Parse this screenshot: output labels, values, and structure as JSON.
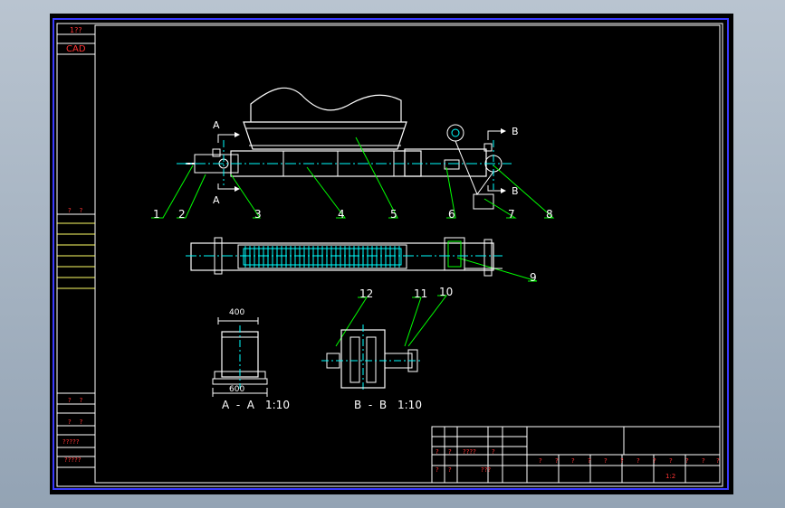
{
  "colors": {
    "background": "#000000",
    "frame": "#3a3aff",
    "outline": "#ffffff",
    "leader": "#00ff00",
    "center": "#00ffff",
    "hidden": "#ff00ff",
    "title_text": "#ff3333",
    "title_line": "#ffff66"
  },
  "side_strip": {
    "top_text": "1??",
    "cad_text": "CAD",
    "mid_text": "?    ?",
    "lower_text_1": "?    ?",
    "lower_text_2": "?    ?",
    "lower_text_3": "?????",
    "lower_text_4": "?????"
  },
  "section_markers": {
    "a_top": "A",
    "a_bottom": "A",
    "b_top": "B",
    "b_bottom": "B"
  },
  "part_labels": [
    "1",
    "2",
    "3",
    "4",
    "5",
    "6",
    "7",
    "8",
    "9",
    "10",
    "11",
    "12"
  ],
  "dimensions": {
    "top_width": "400",
    "bottom_width": "600"
  },
  "view_captions": {
    "section_a": "A  -  A",
    "section_a_scale": "1:10",
    "section_b": "B  -  B",
    "section_b_scale": "1:10"
  },
  "title_block": {
    "cells_row_1": [
      "?",
      "?",
      "?",
      "?",
      "?",
      "?",
      "?",
      "?",
      "?",
      "?",
      "?",
      "?"
    ],
    "cells_left": [
      "?",
      "?",
      "????",
      "?",
      "?",
      "?"
    ],
    "stamp": "???",
    "scale": "1:2"
  }
}
